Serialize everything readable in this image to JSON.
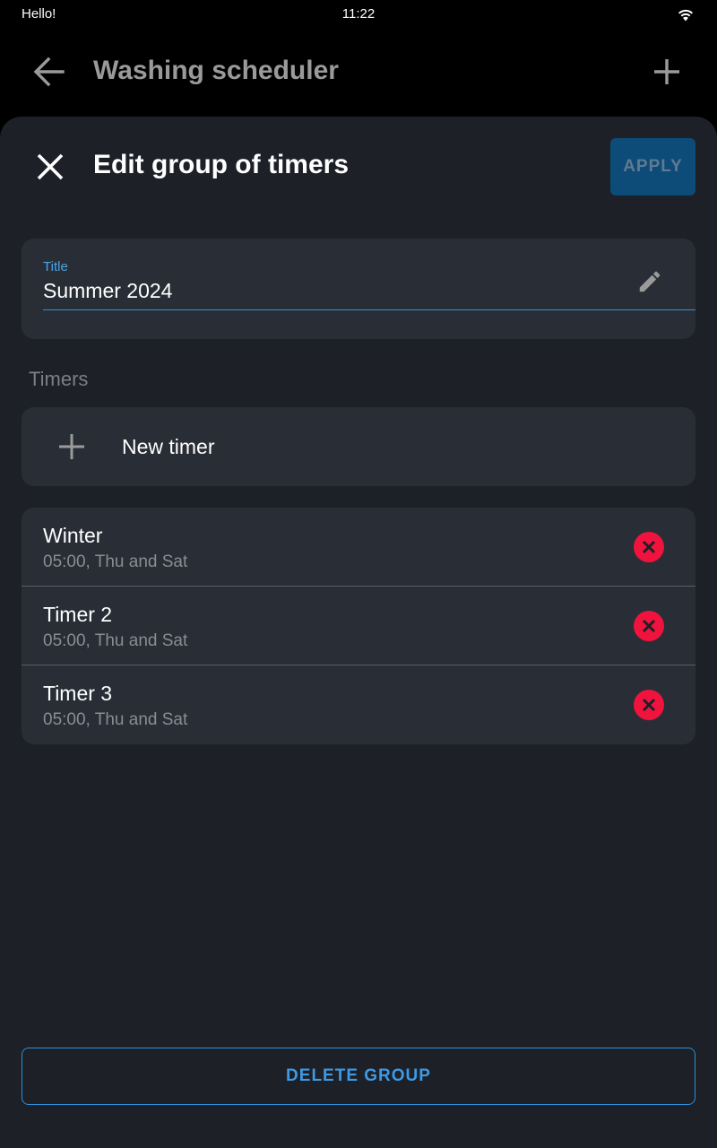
{
  "status_bar": {
    "left_text": "Hello!",
    "time": "11:22",
    "icon": "wifi-icon"
  },
  "app_bar": {
    "title": "Washing scheduler",
    "back_icon": "back-arrow-icon",
    "add_icon": "plus-icon"
  },
  "sheet": {
    "title": "Edit group of timers",
    "close_icon": "close-icon",
    "apply_label": "APPLY",
    "title_field": {
      "label": "Title",
      "value": "Summer 2024",
      "icon": "pencil-icon"
    },
    "section_label": "Timers",
    "new_timer": {
      "label": "New timer",
      "icon": "plus-icon"
    },
    "timers": [
      {
        "name": "Winter",
        "schedule": "05:00, Thu and Sat"
      },
      {
        "name": "Timer 2",
        "schedule": "05:00, Thu and Sat"
      },
      {
        "name": "Timer 3",
        "schedule": "05:00, Thu and Sat"
      }
    ],
    "delete_label": "DELETE GROUP"
  },
  "colors": {
    "accent": "#2f8fd8",
    "apply_bg": "#0d4b78",
    "remove": "#f0133e",
    "sheet_bg": "#1d2027",
    "card_bg": "#292e36"
  }
}
